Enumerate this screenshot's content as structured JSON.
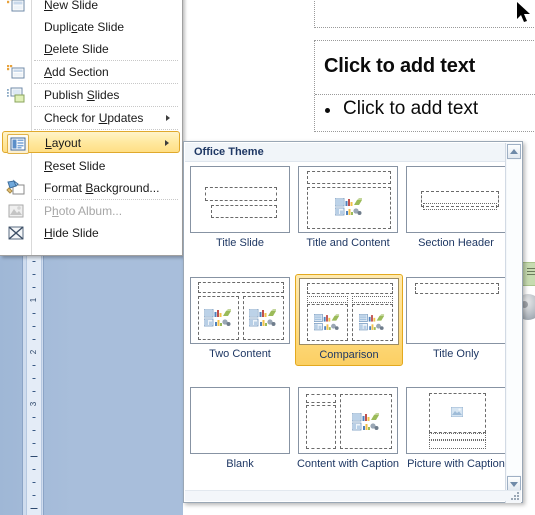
{
  "context_menu": {
    "name": "slide-context-menu",
    "items": [
      {
        "label": "New Slide",
        "accel": "N",
        "icon": "new-slide-icon",
        "enabled": true,
        "submenu": false,
        "highlighted": false
      },
      {
        "label": "Duplicate Slide",
        "accel": "c",
        "icon": "none",
        "enabled": true,
        "submenu": false,
        "highlighted": false
      },
      {
        "label": "Delete Slide",
        "accel": "D",
        "icon": "none",
        "enabled": true,
        "submenu": false,
        "highlighted": false
      },
      {
        "label": "Add Section",
        "accel": "A",
        "icon": "add-section-icon",
        "enabled": true,
        "submenu": false,
        "highlighted": false
      },
      {
        "label": "Publish Slides",
        "accel": "S",
        "icon": "publish-slides-icon",
        "enabled": true,
        "submenu": false,
        "highlighted": false
      },
      {
        "label": "Check for Updates",
        "accel": "U",
        "icon": "none",
        "enabled": true,
        "submenu": true,
        "highlighted": false
      },
      {
        "label": "Layout",
        "accel": "L",
        "icon": "layout-icon",
        "enabled": true,
        "submenu": true,
        "highlighted": true
      },
      {
        "label": "Reset Slide",
        "accel": "R",
        "icon": "none",
        "enabled": true,
        "submenu": false,
        "highlighted": false
      },
      {
        "label": "Format Background...",
        "accel": "B",
        "icon": "format-background-icon",
        "enabled": true,
        "submenu": false,
        "highlighted": false
      },
      {
        "label": "Photo Album...",
        "accel": "",
        "icon": "photo-album-icon",
        "enabled": false,
        "submenu": false,
        "highlighted": false
      },
      {
        "label": "Hide Slide",
        "accel": "H",
        "icon": "hide-slide-icon",
        "enabled": true,
        "submenu": false,
        "highlighted": false
      }
    ]
  },
  "layout_gallery": {
    "header": "Office Theme",
    "selected": "Comparison",
    "layouts": [
      {
        "name": "Title Slide",
        "kind": "title-slide"
      },
      {
        "name": "Title and Content",
        "kind": "title-and-content"
      },
      {
        "name": "Section Header",
        "kind": "section-header"
      },
      {
        "name": "Two Content",
        "kind": "two-content"
      },
      {
        "name": "Comparison",
        "kind": "comparison"
      },
      {
        "name": "Title Only",
        "kind": "title-only"
      },
      {
        "name": "Blank",
        "kind": "blank"
      },
      {
        "name": "Content with Caption",
        "kind": "content-with-caption"
      },
      {
        "name": "Picture with Caption",
        "kind": "picture-with-caption"
      }
    ],
    "scrollbar": {
      "up": "scroll-up-arrow",
      "down": "scroll-down-arrow"
    }
  },
  "slide_editor": {
    "title_placeholder": "",
    "body_heading": "Click to add text",
    "body_bullet": "Click to add text"
  },
  "ruler": {
    "orientation": "vertical",
    "labels": [
      "1",
      "2",
      "3"
    ],
    "unit": "inches"
  },
  "colors": {
    "highlight_start": "#fff4c9",
    "highlight_end": "#ffdf85",
    "highlight_border": "#e0a92c",
    "selection_start": "#ffeab0",
    "selection_end": "#fbcf63",
    "selection_border": "#e3a91f",
    "gallery_text": "#1f3864",
    "pane_background": "#a8bedb"
  }
}
